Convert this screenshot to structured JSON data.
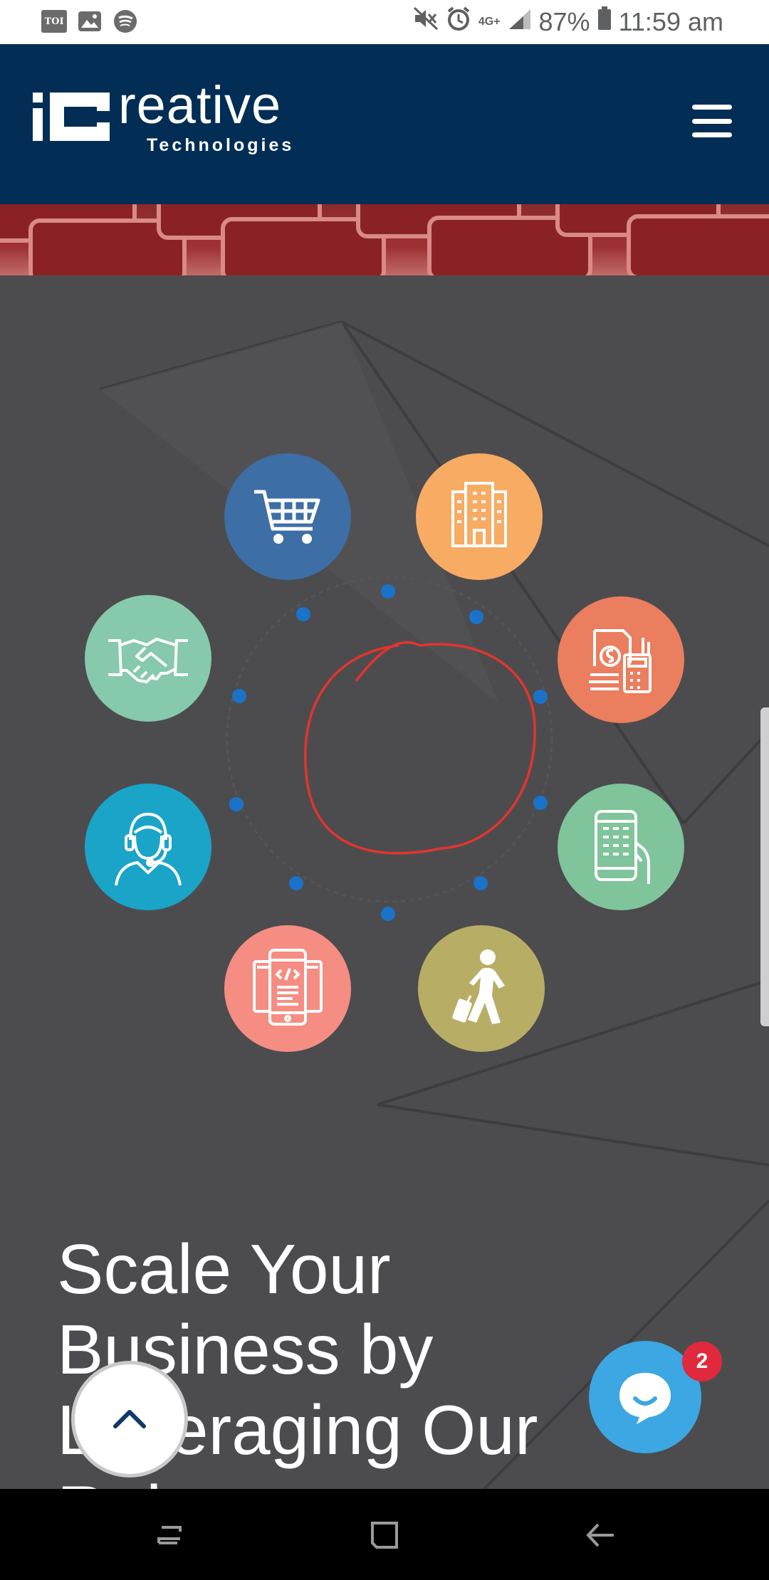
{
  "status_bar": {
    "left_icons": [
      "toi-icon",
      "image-icon",
      "spotify-icon"
    ],
    "toi_label": "TOI",
    "network_label": "4G+",
    "battery": "87%",
    "time": "11:59 am"
  },
  "header": {
    "logo_main": "reative",
    "logo_sub": "Technologies",
    "colors": {
      "background": "#022d55",
      "text": "#ffffff"
    }
  },
  "services": [
    {
      "icon": "shopping-cart-icon",
      "color": "#3e6ea6"
    },
    {
      "icon": "building-icon",
      "color": "#f8ab63"
    },
    {
      "icon": "handshake-icon",
      "color": "#86c9ad"
    },
    {
      "icon": "finance-calculator-icon",
      "color": "#ea7e5e"
    },
    {
      "icon": "customer-support-icon",
      "color": "#1aa4c8"
    },
    {
      "icon": "mobile-app-icon",
      "color": "#7fc49b"
    },
    {
      "icon": "responsive-code-icon",
      "color": "#f58d83"
    },
    {
      "icon": "traveler-icon",
      "color": "#b8ad65"
    }
  ],
  "hero": {
    "headline": "Scale Your Business by Leveraging Our Robust"
  },
  "chat": {
    "badge_count": "2",
    "color": "#3ca7e2"
  },
  "colors": {
    "section_bg": "#4c4c4e",
    "dot": "#1a73c9",
    "annotation": "#e3342f"
  }
}
